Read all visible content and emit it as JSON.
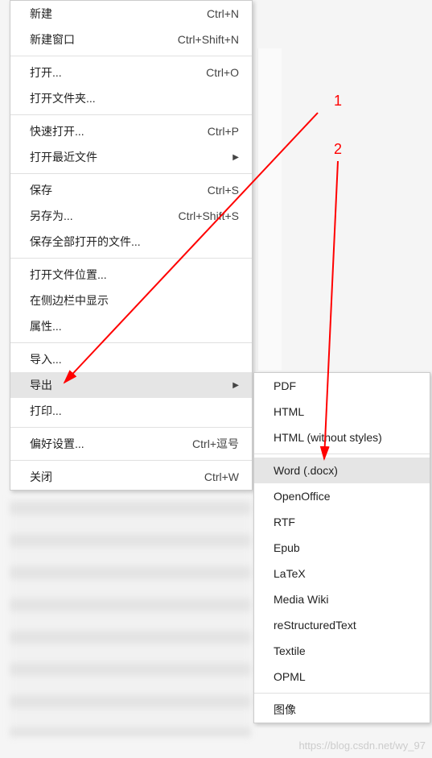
{
  "annotations": {
    "label1": "1",
    "label2": "2"
  },
  "mainMenu": {
    "groups": [
      [
        {
          "label": "新建",
          "shortcut": "Ctrl+N",
          "hasSubmenu": false
        },
        {
          "label": "新建窗口",
          "shortcut": "Ctrl+Shift+N",
          "hasSubmenu": false
        }
      ],
      [
        {
          "label": "打开...",
          "shortcut": "Ctrl+O",
          "hasSubmenu": false
        },
        {
          "label": "打开文件夹...",
          "shortcut": "",
          "hasSubmenu": false
        }
      ],
      [
        {
          "label": "快速打开...",
          "shortcut": "Ctrl+P",
          "hasSubmenu": false
        },
        {
          "label": "打开最近文件",
          "shortcut": "",
          "hasSubmenu": true
        }
      ],
      [
        {
          "label": "保存",
          "shortcut": "Ctrl+S",
          "hasSubmenu": false
        },
        {
          "label": "另存为...",
          "shortcut": "Ctrl+Shift+S",
          "hasSubmenu": false
        },
        {
          "label": "保存全部打开的文件...",
          "shortcut": "",
          "hasSubmenu": false
        }
      ],
      [
        {
          "label": "打开文件位置...",
          "shortcut": "",
          "hasSubmenu": false
        },
        {
          "label": "在侧边栏中显示",
          "shortcut": "",
          "hasSubmenu": false
        },
        {
          "label": "属性...",
          "shortcut": "",
          "hasSubmenu": false
        }
      ],
      [
        {
          "label": "导入...",
          "shortcut": "",
          "hasSubmenu": false
        },
        {
          "label": "导出",
          "shortcut": "",
          "hasSubmenu": true,
          "highlighted": true
        },
        {
          "label": "打印...",
          "shortcut": "",
          "hasSubmenu": false
        }
      ],
      [
        {
          "label": "偏好设置...",
          "shortcut": "Ctrl+逗号",
          "hasSubmenu": false
        }
      ],
      [
        {
          "label": "关闭",
          "shortcut": "Ctrl+W",
          "hasSubmenu": false
        }
      ]
    ]
  },
  "subMenu": {
    "groups": [
      [
        {
          "label": "PDF"
        },
        {
          "label": "HTML"
        },
        {
          "label": "HTML (without styles)"
        }
      ],
      [
        {
          "label": "Word (.docx)",
          "highlighted": true
        },
        {
          "label": "OpenOffice"
        },
        {
          "label": "RTF"
        },
        {
          "label": "Epub"
        },
        {
          "label": "LaTeX"
        },
        {
          "label": "Media Wiki"
        },
        {
          "label": "reStructuredText"
        },
        {
          "label": "Textile"
        },
        {
          "label": "OPML"
        }
      ],
      [
        {
          "label": "图像"
        }
      ]
    ]
  },
  "watermark": "https://blog.csdn.net/wy_97"
}
